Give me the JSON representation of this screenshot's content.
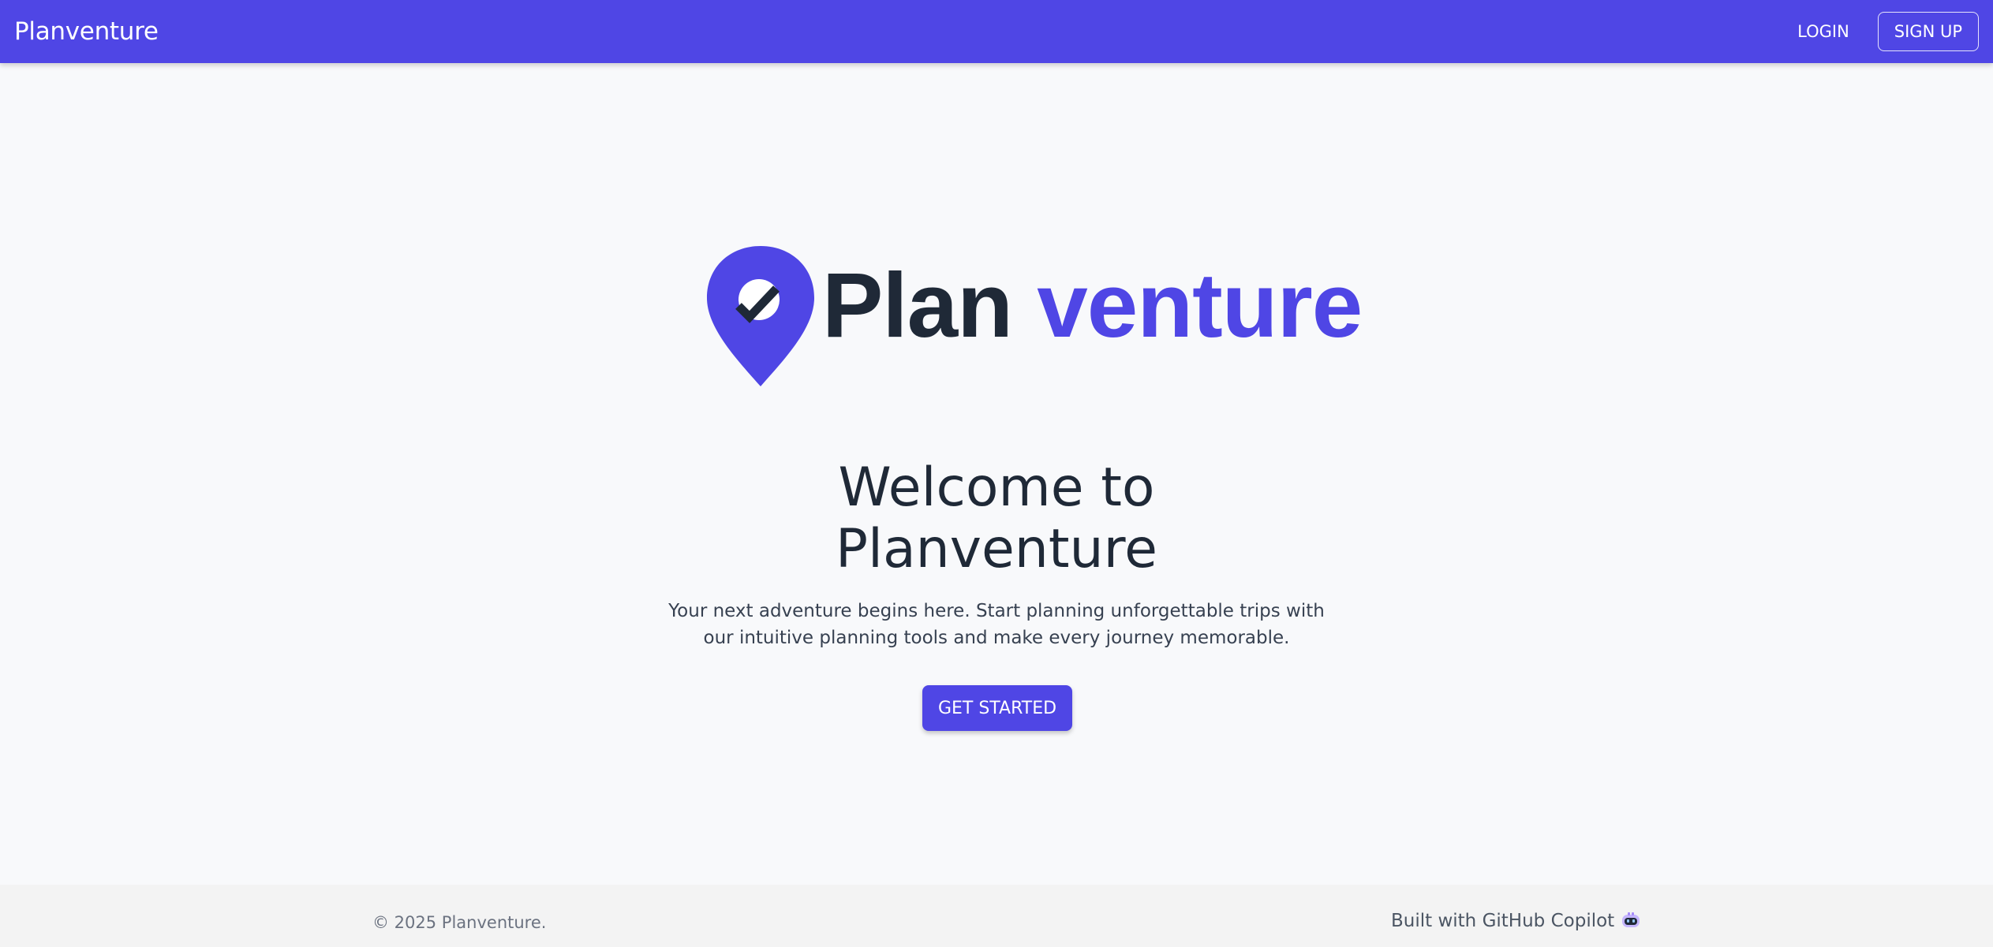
{
  "navbar": {
    "brand": "Planventure",
    "login_label": "LOGIN",
    "signup_label": "SIGN UP",
    "background_color": "#4f46e5"
  },
  "logo": {
    "word_plan": "Plan",
    "word_venture": "venture",
    "icon": "map-pin-check-icon",
    "accent_color": "#4f46e5",
    "dark_color": "#1f2937"
  },
  "hero": {
    "title_line1": "Welcome to",
    "title_line2": "Planventure",
    "subtitle_line1": "Your next adventure begins here. Start planning unforgettable trips with",
    "subtitle_line2": "our intuitive planning tools and make every journey memorable.",
    "cta_label": "GET STARTED"
  },
  "footer": {
    "copyright": "© 2025 Planventure.",
    "built_with": "Built with GitHub Copilot",
    "built_with_icon": "copilot-icon"
  }
}
